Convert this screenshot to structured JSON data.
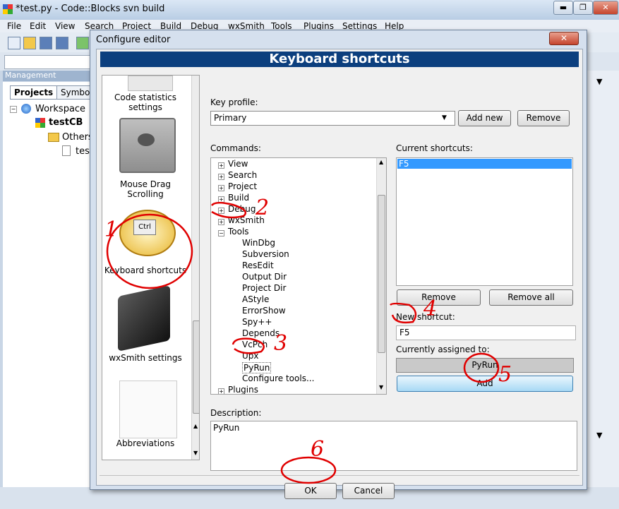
{
  "window": {
    "title": "*test.py - Code::Blocks svn build",
    "controls": [
      "▬",
      "❐",
      "✕"
    ]
  },
  "menubar": [
    "File",
    "Edit",
    "View",
    "Search",
    "Project",
    "Build",
    "Debug",
    "wxSmith",
    "Tools",
    "Plugins",
    "Settings",
    "Help"
  ],
  "management": {
    "header": "Management",
    "tabs": [
      "Projects",
      "Symbols"
    ],
    "tree": {
      "workspace": "Workspace",
      "project": "testCB",
      "folder": "Others",
      "file": "test"
    }
  },
  "dialog": {
    "title": "Configure editor",
    "close": "✕",
    "header": "Keyboard shortcuts",
    "left_items": [
      "Code statistics settings",
      "Mouse Drag Scrolling",
      "Keyboard shortcuts",
      "wxSmith settings",
      "Abbreviations"
    ],
    "key_profile_label": "Key profile:",
    "key_profile_value": "Primary",
    "add_new": "Add new",
    "remove_profile": "Remove",
    "commands_label": "Commands:",
    "commands": [
      "View",
      "Search",
      "Project",
      "Build",
      "Debug",
      "wxSmith",
      "Tools",
      "Plugins"
    ],
    "tools_children": [
      "WinDbg",
      "Subversion",
      "ResEdit",
      "Output Dir",
      "Project Dir",
      "AStyle",
      "ErrorShow",
      "Spy++",
      "Depends",
      "VcPch",
      "Upx",
      "PyRun",
      "Configure tools..."
    ],
    "current_shortcuts_label": "Current shortcuts:",
    "current_shortcuts": [
      "F5"
    ],
    "remove": "Remove",
    "remove_all": "Remove all",
    "new_shortcut_label": "New shortcut:",
    "new_shortcut_value": "F5",
    "currently_assigned_label": "Currently assigned to:",
    "currently_assigned_value": "PyRun",
    "add": "Add",
    "description_label": "Description:",
    "description_value": "PyRun",
    "ok": "OK",
    "cancel": "Cancel"
  },
  "annotations": [
    "1",
    "2",
    "3",
    "4",
    "5",
    "6"
  ],
  "colors": {
    "header_band": "#0c3f7e",
    "annotation": "#e00000",
    "selection": "#3399ff"
  }
}
